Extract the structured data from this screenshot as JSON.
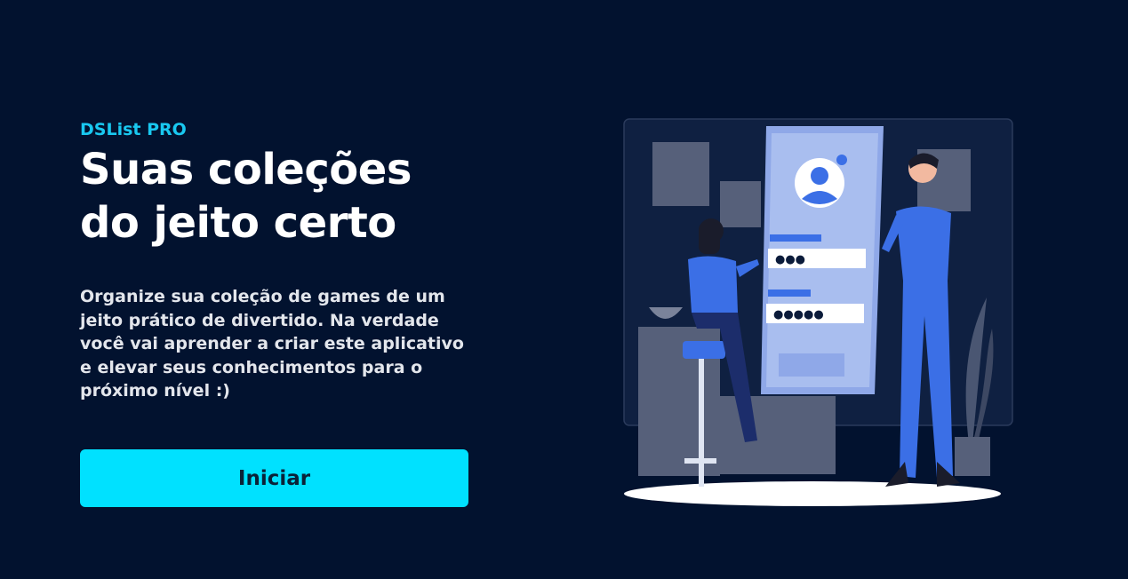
{
  "hero": {
    "brand": "DSList PRO",
    "title_line1": "Suas coleções",
    "title_line2": "do jeito certo",
    "description": "Organize sua coleção de games de um jeito prático de divertido. Na verdade você vai aprender a criar este aplicativo e elevar seus conhecimentos para o próximo nível :)",
    "button_label": "Iniciar"
  },
  "illustration": {
    "icon": "login-illustration",
    "password_dots_1": "●●●",
    "password_dots_2": "●●●●●"
  },
  "colors": {
    "background": "#02122f",
    "accent": "#00e1ff",
    "brand": "#19c8f0"
  }
}
